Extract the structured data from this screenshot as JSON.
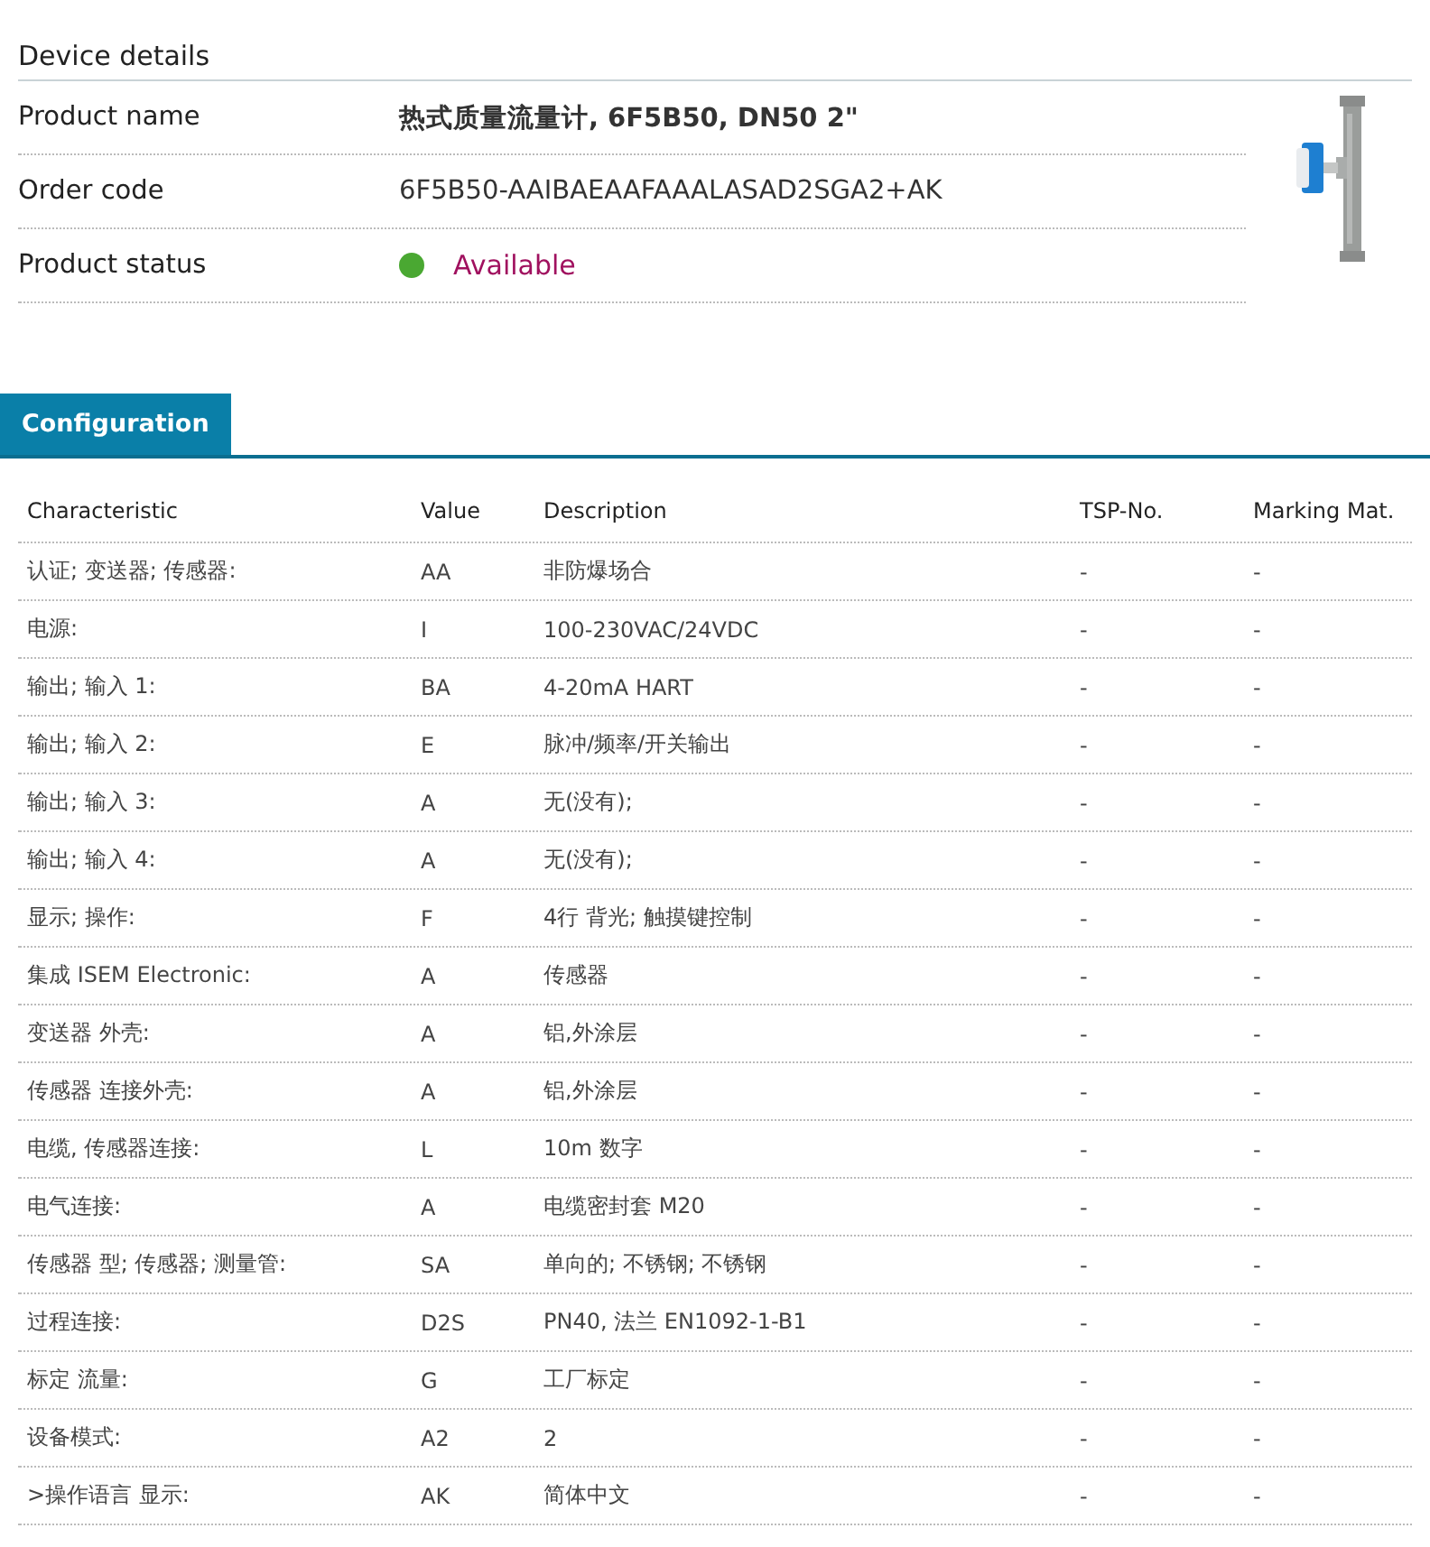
{
  "device_details": {
    "title": "Device details",
    "fields": [
      {
        "label": "Product name",
        "value": "热式质量流量计, 6F5B50, DN50 2\"",
        "kind": "bold"
      },
      {
        "label": "Order code",
        "value": "6F5B50-AAIBAEAAFAAALASAD2SGA2+AK",
        "kind": "plain"
      },
      {
        "label": "Product status",
        "value": "Available",
        "kind": "status",
        "color": "#4aa832"
      }
    ]
  },
  "tabs": [
    {
      "label": "Configuration",
      "selected": true
    }
  ],
  "table": {
    "columns": [
      "Characteristic",
      "Value",
      "Description",
      "TSP-No.",
      "Marking Mat."
    ],
    "rows": [
      [
        "认证; 变送器; 传感器:",
        "AA",
        "非防爆场合",
        "-",
        "-"
      ],
      [
        "电源:",
        "I",
        "100-230VAC/24VDC",
        "-",
        "-"
      ],
      [
        "输出; 输入 1:",
        "BA",
        "4-20mA HART",
        "-",
        "-"
      ],
      [
        "输出; 输入 2:",
        "E",
        "脉冲/频率/开关输出",
        "-",
        "-"
      ],
      [
        "输出; 输入 3:",
        "A",
        "无(没有);",
        "-",
        "-"
      ],
      [
        "输出; 输入 4:",
        "A",
        "无(没有);",
        "-",
        "-"
      ],
      [
        "显示; 操作:",
        "F",
        "4行 背光; 触摸键控制",
        "-",
        "-"
      ],
      [
        "集成 ISEM Electronic:",
        "A",
        "传感器",
        "-",
        "-"
      ],
      [
        "变送器 外壳:",
        "A",
        "铝,外涂层",
        "-",
        "-"
      ],
      [
        "传感器 连接外壳:",
        "A",
        "铝,外涂层",
        "-",
        "-"
      ],
      [
        "电缆, 传感器连接:",
        "L",
        "10m 数字",
        "-",
        "-"
      ],
      [
        "电气连接:",
        "A",
        "电缆密封套 M20",
        "-",
        "-"
      ],
      [
        "传感器 型; 传感器; 测量管:",
        "SA",
        "单向的; 不锈钢; 不锈钢",
        "-",
        "-"
      ],
      [
        "过程连接:",
        "D2S",
        "PN40, 法兰 EN1092-1-B1",
        "-",
        "-"
      ],
      [
        "标定 流量:",
        "G",
        "工厂标定",
        "-",
        "-"
      ],
      [
        "设备模式:",
        "A2",
        "2",
        "-",
        "-"
      ],
      [
        ">操作语言 显示:",
        "AK",
        "简体中文",
        "-",
        "-"
      ]
    ]
  }
}
